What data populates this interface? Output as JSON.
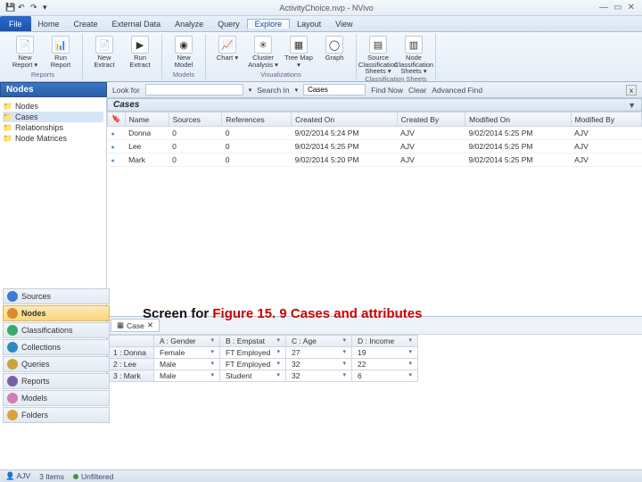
{
  "window": {
    "title": "ActivityChoice.nvp - NVivo",
    "qat_icons": [
      "save-icon",
      "undo-icon",
      "redo-icon",
      "dropdown-icon"
    ]
  },
  "ribbon": {
    "file": "File",
    "tabs": [
      "Home",
      "Create",
      "External Data",
      "Analyze",
      "Query",
      "Explore",
      "Layout",
      "View"
    ],
    "active_tab": "Explore",
    "groups": [
      {
        "name": "Reports",
        "buttons": [
          {
            "label": "New Report ▾",
            "icon": "📄"
          },
          {
            "label": "Run Report",
            "icon": "📊"
          }
        ]
      },
      {
        "name": "",
        "buttons": [
          {
            "label": "New Extract",
            "icon": "📄"
          },
          {
            "label": "Run Extract",
            "icon": "▶"
          }
        ]
      },
      {
        "name": "Models",
        "buttons": [
          {
            "label": "New Model",
            "icon": "◉"
          }
        ]
      },
      {
        "name": "Visualizations",
        "buttons": [
          {
            "label": "Chart ▾",
            "icon": "📈"
          },
          {
            "label": "Cluster Analysis ▾",
            "icon": "✳"
          },
          {
            "label": "Tree Map ▾",
            "icon": "▦"
          },
          {
            "label": "Graph",
            "icon": "◯"
          }
        ]
      },
      {
        "name": "Classification Sheets",
        "buttons": [
          {
            "label": "Source Classification Sheets ▾",
            "icon": "▤"
          },
          {
            "label": "Node Classification Sheets ▾",
            "icon": "▥"
          }
        ]
      }
    ]
  },
  "nav": {
    "label": "Nodes",
    "tree": [
      {
        "label": "Nodes",
        "sel": false
      },
      {
        "label": "Cases",
        "sel": true
      },
      {
        "label": "Relationships",
        "sel": false
      },
      {
        "label": "Node Matrices",
        "sel": false
      }
    ],
    "bottom_groups": [
      {
        "label": "Sources",
        "color": "#3a7bd5"
      },
      {
        "label": "Nodes",
        "color": "#d98b2e",
        "sel": true
      },
      {
        "label": "Classifications",
        "color": "#3aa86b"
      },
      {
        "label": "Collections",
        "color": "#2e8bc0"
      },
      {
        "label": "Queries",
        "color": "#caa23a"
      },
      {
        "label": "Reports",
        "color": "#7a5fa8"
      },
      {
        "label": "Models",
        "color": "#d47bbb"
      },
      {
        "label": "Folders",
        "color": "#d9a23a"
      }
    ]
  },
  "search": {
    "look_for_label": "Look for",
    "look_for_value": "",
    "search_in_label": "Search In",
    "search_in_value": "Cases",
    "find_now": "Find Now",
    "clear": "Clear",
    "advanced": "Advanced Find"
  },
  "cases_panel": {
    "header": "Cases",
    "columns": [
      "Name",
      "Sources",
      "References",
      "Created On",
      "Created By",
      "Modified On",
      "Modified By"
    ],
    "rows": [
      {
        "name": "Donna",
        "sources": "0",
        "refs": "0",
        "created": "9/02/2014 5:24 PM",
        "cby": "AJV",
        "modified": "9/02/2014 5:25 PM",
        "mby": "AJV"
      },
      {
        "name": "Lee",
        "sources": "0",
        "refs": "0",
        "created": "9/02/2014 5:25 PM",
        "cby": "AJV",
        "modified": "9/02/2014 5:25 PM",
        "mby": "AJV"
      },
      {
        "name": "Mark",
        "sources": "0",
        "refs": "0",
        "created": "9/02/2014 5:20 PM",
        "cby": "AJV",
        "modified": "9/02/2014 5:25 PM",
        "mby": "AJV"
      }
    ]
  },
  "attr_panel": {
    "tab_label": "Case",
    "columns": [
      "",
      "A : Gender",
      "B : Empstat",
      "C : Age",
      "D : Income"
    ],
    "rows": [
      {
        "n": "1 : Donna",
        "gender": "Female",
        "emp": "FT Employed",
        "age": "27",
        "income": "19"
      },
      {
        "n": "2 : Lee",
        "gender": "Male",
        "emp": "FT Employed",
        "age": "32",
        "income": "22"
      },
      {
        "n": "3 : Mark",
        "gender": "Male",
        "emp": "Student",
        "age": "32",
        "income": "6"
      }
    ]
  },
  "caption_prefix": "Screen for ",
  "caption_fig": "Figure 15. 9  Cases and attributes",
  "status": {
    "user": "AJV",
    "items": "3 Items",
    "filter": "Unfiltered"
  }
}
